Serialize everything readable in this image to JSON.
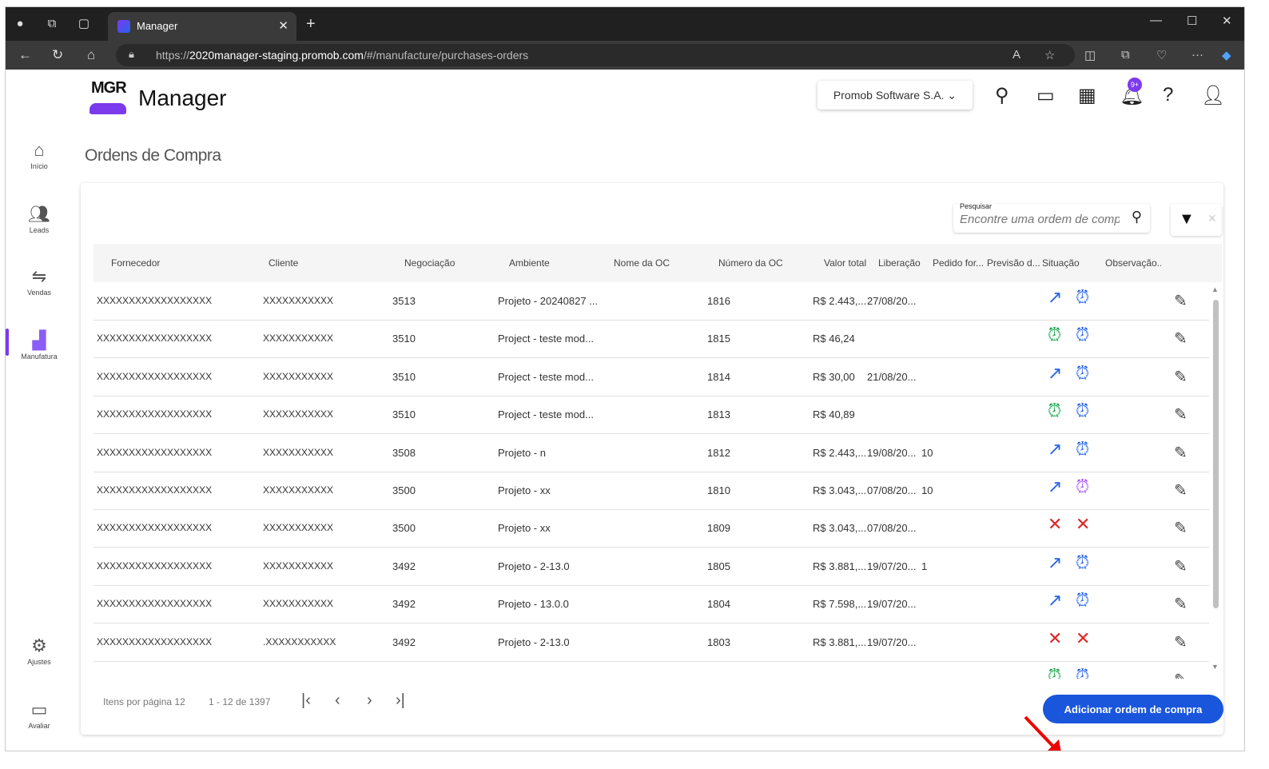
{
  "browser": {
    "tab_title": "Manager",
    "url_prefix": "https://",
    "url_host": "2020manager-staging.promob.com",
    "url_path": "/#/manufacture/purchases-orders"
  },
  "header": {
    "logo_text": "MGR",
    "app_name": "Manager",
    "company": "Promob Software S.A.",
    "notif_badge": "9+"
  },
  "sidebar": {
    "items": [
      {
        "label": "Início",
        "icon": "home-icon"
      },
      {
        "label": "Leads",
        "icon": "group-icon"
      },
      {
        "label": "Vendas",
        "icon": "handshake-icon"
      },
      {
        "label": "Manufatura",
        "icon": "factory-icon"
      },
      {
        "label": "Ajustes",
        "icon": "gear-icon"
      },
      {
        "label": "Avaliar",
        "icon": "comment-icon"
      }
    ]
  },
  "page": {
    "title": "Ordens de Compra",
    "search_label": "Pesquisar",
    "search_placeholder": "Encontre uma ordem de compra"
  },
  "table": {
    "columns": [
      "Fornecedor",
      "Cliente",
      "Negociação",
      "Ambiente",
      "Nome da OC",
      "Número da OC",
      "Valor total",
      "Liberação",
      "Pedido for...",
      "Previsão d...",
      "Situação",
      "Observação..."
    ],
    "rows": [
      {
        "fornecedor": "XXXXXXXXXXXXXXXXXXXX",
        "cliente": "XXXXXXXXXXX",
        "negociacao": "3513",
        "ambiente": "Projeto - 20240827 ...",
        "numero": "1816",
        "valor": "R$ 2.443,...",
        "liberacao": "27/08/20...",
        "pedido": "",
        "s1": "arrow",
        "s2": "clock-blue"
      },
      {
        "fornecedor": "XXXXXXXXXXXXXXXXXXXX",
        "cliente": "XXXXXXXXXXX",
        "negociacao": "3510",
        "ambiente": "Project - teste mod...",
        "numero": "1815",
        "valor": "R$ 46,24",
        "liberacao": "",
        "pedido": "",
        "s1": "clock-green",
        "s2": "clock-blue"
      },
      {
        "fornecedor": "XXXXXXXXXXXXXXXXXXXX",
        "cliente": "XXXXXXXXXXX",
        "negociacao": "3510",
        "ambiente": "Project - teste mod...",
        "numero": "1814",
        "valor": "R$ 30,00",
        "liberacao": "21/08/20...",
        "pedido": "",
        "s1": "arrow",
        "s2": "clock-blue"
      },
      {
        "fornecedor": "XXXXXXXXXXXXXXXXXXXX",
        "cliente": "XXXXXXXXXXX",
        "negociacao": "3510",
        "ambiente": "Project - teste mod...",
        "numero": "1813",
        "valor": "R$ 40,89",
        "liberacao": "",
        "pedido": "",
        "s1": "clock-green",
        "s2": "clock-blue"
      },
      {
        "fornecedor": "XXXXXXXXXXXXXXXXXXXX",
        "cliente": "XXXXXXXXXXX",
        "negociacao": "3508",
        "ambiente": "Projeto - n",
        "numero": "1812",
        "valor": "R$ 2.443,...",
        "liberacao": "19/08/20...",
        "pedido": "10",
        "s1": "arrow",
        "s2": "clock-blue"
      },
      {
        "fornecedor": "XXXXXXXXXXXXXXXXXXXX",
        "cliente": "XXXXXXXXXXX",
        "negociacao": "3500",
        "ambiente": "Projeto - xx",
        "numero": "1810",
        "valor": "R$ 3.043,...",
        "liberacao": "07/08/20...",
        "pedido": "10",
        "s1": "arrow",
        "s2": "clock-check"
      },
      {
        "fornecedor": "XXXXXXXXXXXXXXXXXXXX",
        "cliente": "XXXXXXXXXXX",
        "negociacao": "3500",
        "ambiente": "Projeto - xx",
        "numero": "1809",
        "valor": "R$ 3.043,...",
        "liberacao": "07/08/20...",
        "pedido": "",
        "s1": "x",
        "s2": "x"
      },
      {
        "fornecedor": "XXXXXXXXXXXXXXXXXXXX",
        "cliente": "XXXXXXXXXXX",
        "negociacao": "3492",
        "ambiente": "Projeto - 2-13.0",
        "numero": "1805",
        "valor": "R$ 3.881,...",
        "liberacao": "19/07/20...",
        "pedido": "1",
        "s1": "arrow",
        "s2": "clock-blue"
      },
      {
        "fornecedor": "XXXXXXXXXXXXXXXXXXXX",
        "cliente": "XXXXXXXXXXX",
        "negociacao": "3492",
        "ambiente": "Projeto - 13.0.0",
        "numero": "1804",
        "valor": "R$ 7.598,...",
        "liberacao": "19/07/20...",
        "pedido": "",
        "s1": "arrow",
        "s2": "clock-blue"
      },
      {
        "fornecedor": "XXXXXXXXXXXXXXXXXXXX",
        "cliente": ".XXXXXXXXXXX",
        "negociacao": "3492",
        "ambiente": "Projeto - 2-13.0",
        "numero": "1803",
        "valor": "R$ 3.881,...",
        "liberacao": "19/07/20...",
        "pedido": "",
        "s1": "x",
        "s2": "x"
      },
      {
        "fornecedor": "",
        "cliente": "",
        "negociacao": "",
        "ambiente": "",
        "numero": "",
        "valor": "",
        "liberacao": "",
        "pedido": "",
        "s1": "clock-green",
        "s2": "clock-blue"
      }
    ]
  },
  "pagination": {
    "items_per_page_label": "Itens por página",
    "items_per_page": "12",
    "range": "1 - 12 de 1397"
  },
  "actions": {
    "add_label": "Adicionar ordem de compra"
  },
  "colors": {
    "accent": "#7c3aed",
    "primary_button": "#1a56db",
    "status_blue": "#2563eb",
    "status_green": "#16a34a",
    "status_red": "#dc2626",
    "status_purple": "#a855f7"
  }
}
